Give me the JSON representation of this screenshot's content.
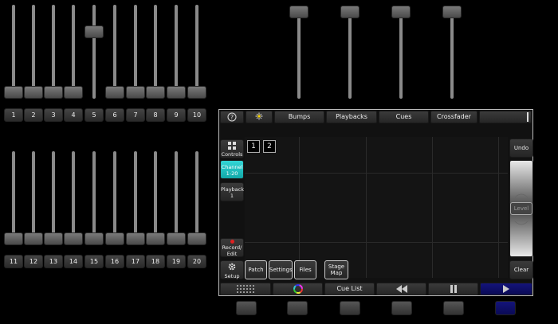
{
  "channels": [
    {
      "label": "1",
      "level": 0
    },
    {
      "label": "2",
      "level": 0
    },
    {
      "label": "3",
      "level": 0
    },
    {
      "label": "4",
      "level": 0
    },
    {
      "label": "5",
      "level": 0.75
    },
    {
      "label": "6",
      "level": 0
    },
    {
      "label": "7",
      "level": 0
    },
    {
      "label": "8",
      "level": 0
    },
    {
      "label": "9",
      "level": 0
    },
    {
      "label": "10",
      "level": 0
    },
    {
      "label": "11",
      "level": 0
    },
    {
      "label": "12",
      "level": 0
    },
    {
      "label": "13",
      "level": 0
    },
    {
      "label": "14",
      "level": 0
    },
    {
      "label": "15",
      "level": 0
    },
    {
      "label": "16",
      "level": 0
    },
    {
      "label": "17",
      "level": 0
    },
    {
      "label": "18",
      "level": 0
    },
    {
      "label": "19",
      "level": 0
    },
    {
      "label": "20",
      "level": 0
    }
  ],
  "playback_faders": [
    {
      "level": 1
    },
    {
      "level": 1
    },
    {
      "level": 1
    },
    {
      "level": 1
    }
  ],
  "tabs": {
    "help_icon": "help-icon",
    "star_icon": "sparkle-icon",
    "bumps": "Bumps",
    "playbacks": "Playbacks",
    "cues": "Cues",
    "crossfader": "Crossfader"
  },
  "sidebar": {
    "controls": "Controls",
    "channel_line1": "Channel",
    "channel_line2": "1-20",
    "playback_line1": "Playback",
    "playback_line2": "1",
    "record_line1": "Record/",
    "record_line2": "Edit",
    "setup": "Setup"
  },
  "pages": [
    "1",
    "2"
  ],
  "setup_buttons": {
    "patch": "Patch",
    "settings": "Settings",
    "files": "Files",
    "stage_line1": "Stage",
    "stage_line2": "Map"
  },
  "right_controls": {
    "undo": "Undo",
    "level": "Level",
    "clear": "Clear"
  },
  "bottom_bar": {
    "cue_list": "Cue List"
  },
  "colors": {
    "accent": "#19b7b7",
    "go_button": "#0b0b6e",
    "record_dot": "#e02020"
  }
}
